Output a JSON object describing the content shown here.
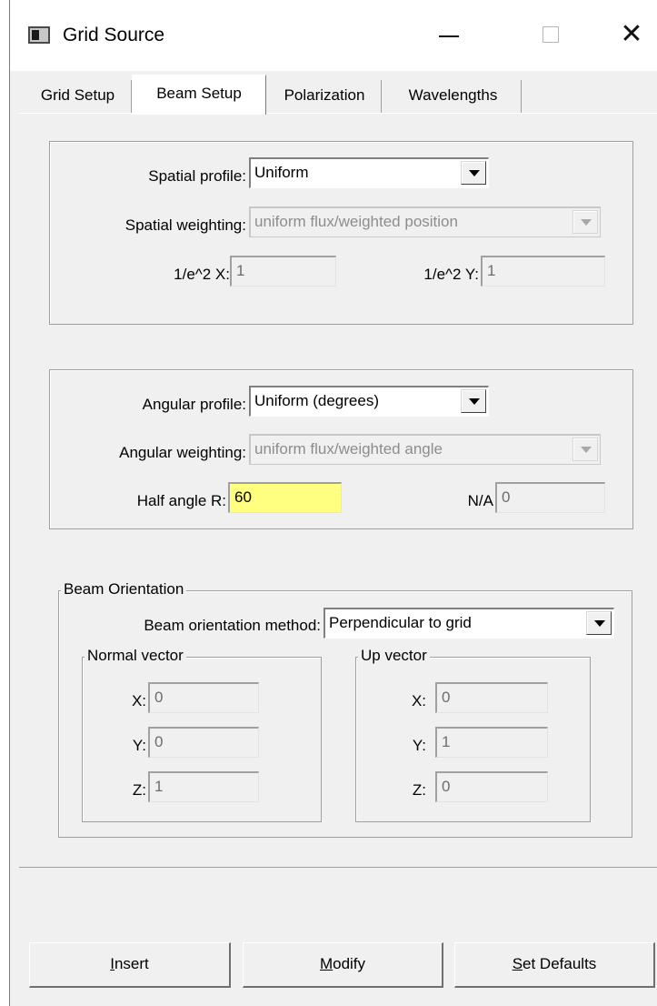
{
  "window": {
    "title": "Grid Source"
  },
  "tabs": [
    {
      "label": "Grid Setup",
      "active": false
    },
    {
      "label": "Beam Setup",
      "active": true
    },
    {
      "label": "Polarization",
      "active": false
    },
    {
      "label": "Wavelengths",
      "active": false
    }
  ],
  "spatial": {
    "profile_label": "Spatial profile:",
    "profile_value": "Uniform",
    "weighting_label": "Spatial weighting:",
    "weighting_value": "uniform flux/weighted position",
    "x_label": "1/e^2 X:",
    "x_value": "1",
    "y_label": "1/e^2 Y:",
    "y_value": "1"
  },
  "angular": {
    "profile_label": "Angular profile:",
    "profile_value": "Uniform (degrees)",
    "weighting_label": "Angular weighting:",
    "weighting_value": "uniform flux/weighted angle",
    "half_angle_label": "Half angle R:",
    "half_angle_value": "60",
    "na_label": "N/A",
    "na_value": "0"
  },
  "orientation": {
    "group_label": "Beam Orientation",
    "method_label": "Beam orientation method:",
    "method_value": "Perpendicular to grid",
    "normal": {
      "group_label": "Normal vector",
      "x_label": "X:",
      "x_value": "0",
      "y_label": "Y:",
      "y_value": "0",
      "z_label": "Z:",
      "z_value": "1"
    },
    "up": {
      "group_label": "Up vector",
      "x_label": "X:",
      "x_value": "0",
      "y_label": "Y:",
      "y_value": "1",
      "z_label": "Z:",
      "z_value": "0"
    }
  },
  "buttons": {
    "insert_mnemonic": "I",
    "insert_rest": "nsert",
    "modify_mnemonic": "M",
    "modify_rest": "odify",
    "defaults_mnemonic": "S",
    "defaults_rest": "et Defaults"
  }
}
